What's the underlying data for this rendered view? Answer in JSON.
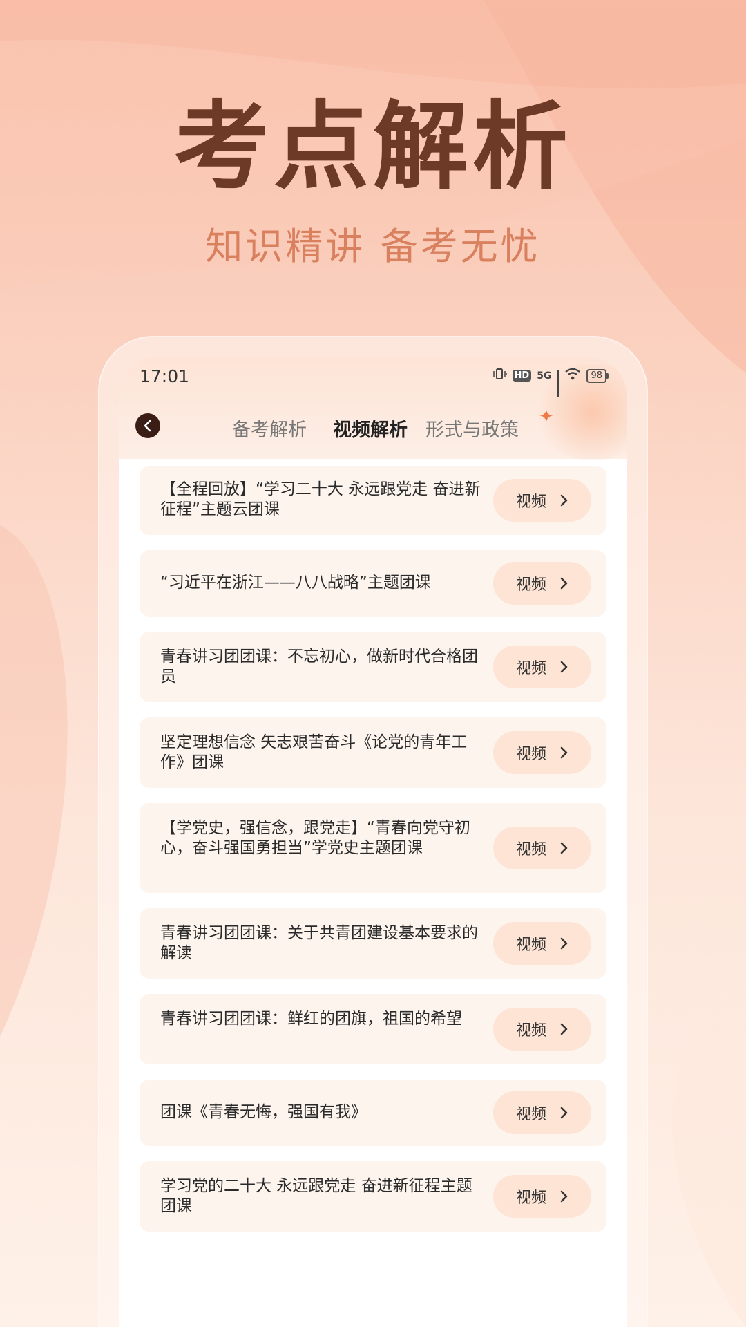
{
  "promo": {
    "title": "考点解析",
    "subtitle": "知识精讲  备考无忧"
  },
  "status_bar": {
    "time": "17:01",
    "network": "5G",
    "hd": "HD",
    "battery": "98"
  },
  "header": {
    "tabs": [
      {
        "label": "备考解析",
        "active": false
      },
      {
        "label": "视频解析",
        "active": true
      },
      {
        "label": "形式与政策",
        "active": false
      }
    ]
  },
  "list": {
    "items": [
      {
        "title": "【全程回放】“学习二十大 永远跟党走 奋进新征程”主题云团课",
        "action": "视频"
      },
      {
        "title": "“习近平在浙江——八八战略”主题团课",
        "action": "视频"
      },
      {
        "title": "青春讲习团团课：不忘初心，做新时代合格团员",
        "action": "视频"
      },
      {
        "title": "坚定理想信念 矢志艰苦奋斗《论党的青年工作》团课",
        "action": "视频"
      },
      {
        "title": "【学党史，强信念，跟党走】“青春向党守初心，奋斗强国勇担当”学党史主题团课",
        "action": "视频"
      },
      {
        "title": "青春讲习团团课：关于共青团建设基本要求的解读",
        "action": "视频"
      },
      {
        "title": "青春讲习团团课：鲜红的团旗，祖国的希望",
        "action": "视频"
      },
      {
        "title": "团课《青春无悔，强国有我》",
        "action": "视频"
      },
      {
        "title": "学习党的二十大 永远跟党走 奋进新征程主题团课",
        "action": "视频"
      }
    ]
  }
}
